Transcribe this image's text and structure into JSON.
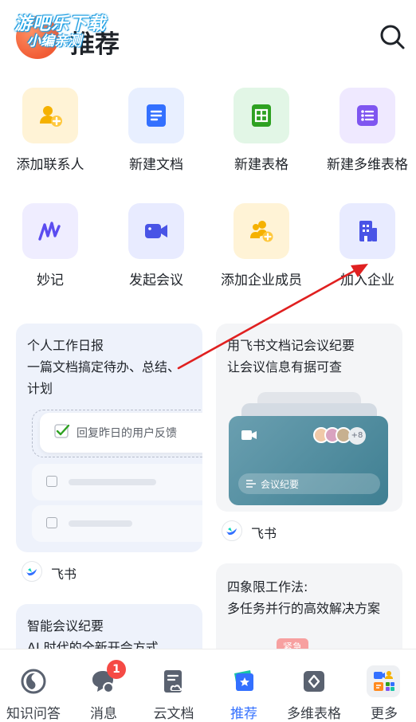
{
  "header": {
    "title": "推荐",
    "watermark_line1": "游吧乐下载",
    "watermark_line2": "小编亲测"
  },
  "quick_actions": [
    {
      "label": "添加联系人",
      "icon": "add-contact-icon"
    },
    {
      "label": "新建文档",
      "icon": "document-icon"
    },
    {
      "label": "新建表格",
      "icon": "sheet-icon"
    },
    {
      "label": "新建多维表格",
      "icon": "base-table-icon"
    },
    {
      "label": "妙记",
      "icon": "minutes-icon"
    },
    {
      "label": "发起会议",
      "icon": "video-meeting-icon"
    },
    {
      "label": "添加企业成员",
      "icon": "add-member-icon"
    },
    {
      "label": "加入企业",
      "icon": "building-icon"
    }
  ],
  "cards": {
    "daily_report": {
      "title_line1": "个人工作日报",
      "title_line2": "一篇文档搞定待办、总结、",
      "title_line3": "计划",
      "todo_checked": "回复昨日的用户反馈",
      "brand": "飞书"
    },
    "meeting_notes_doc": {
      "title_line1": "用飞书文档记会议纪要",
      "title_line2": "让会议信息有据可查",
      "avatar_more": "+8",
      "pill_label": "会议纪要",
      "brand": "飞书"
    },
    "smart_minutes": {
      "title_line1": "智能会议纪要",
      "title_line2": "AI 时代的全新开会方式"
    },
    "quadrant": {
      "title_line1": "四象限工作法:",
      "title_line2": "多任务并行的高效解决方案",
      "tag": "紧急"
    }
  },
  "tabbar": {
    "items": [
      {
        "label": "知识问答",
        "icon": "knowledge-qa-icon"
      },
      {
        "label": "消息",
        "icon": "message-icon"
      },
      {
        "label": "云文档",
        "icon": "cloud-docs-icon"
      },
      {
        "label": "推荐",
        "icon": "recommend-icon"
      },
      {
        "label": "多维表格",
        "icon": "base-icon"
      },
      {
        "label": "更多",
        "icon": "more-apps-icon"
      }
    ],
    "active": "推荐",
    "message_badge": "1"
  },
  "colors": {
    "accent": "#3370ff",
    "badge": "#f54a45",
    "annotation_arrow": "#e02020"
  }
}
